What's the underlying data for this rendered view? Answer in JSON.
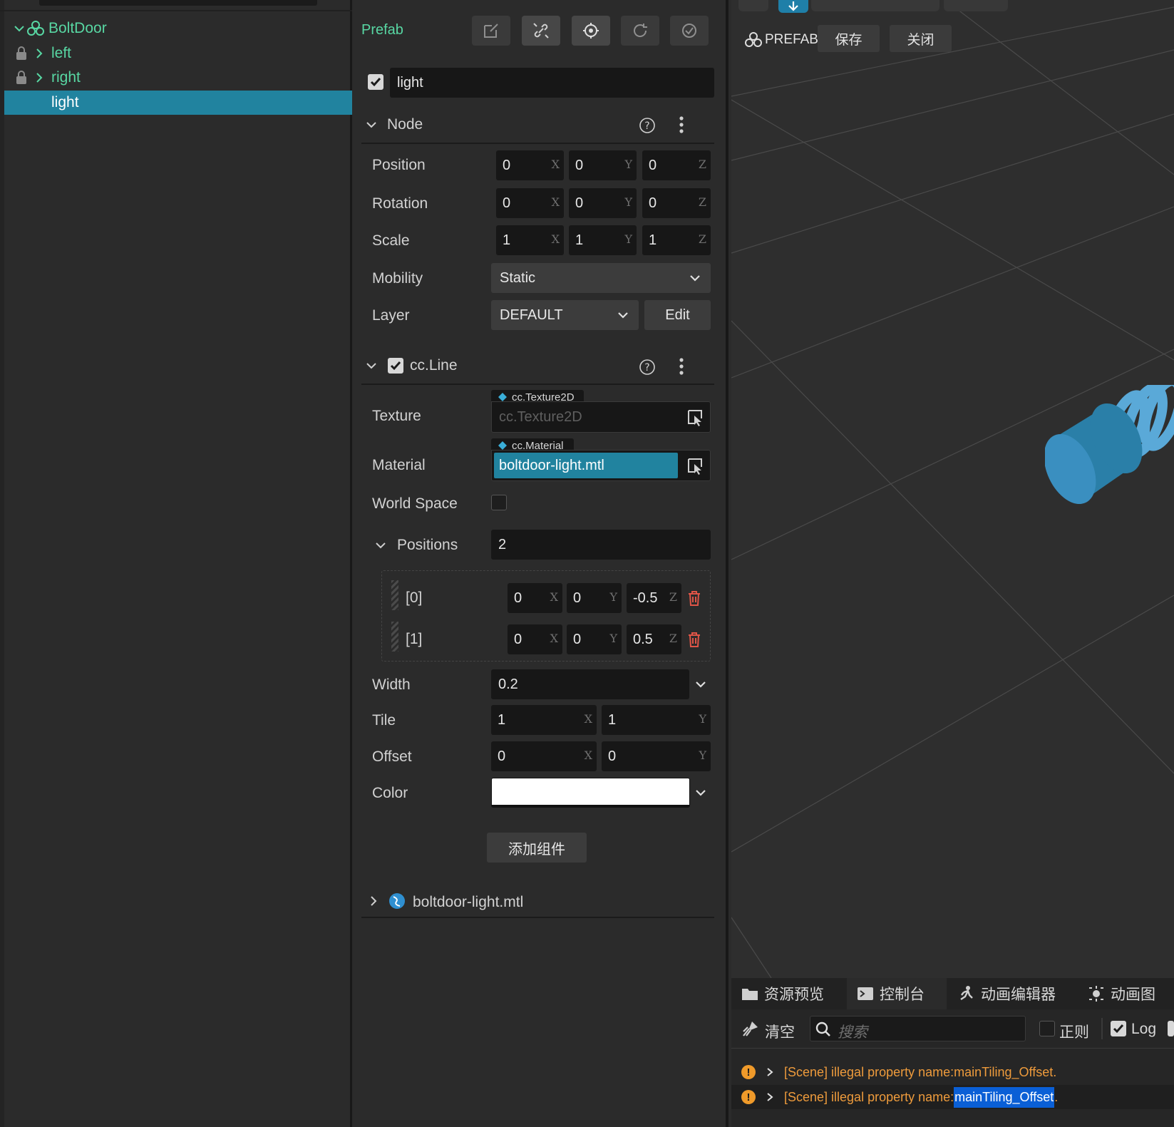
{
  "hierarchy": {
    "items": [
      {
        "label": "BoltDoor"
      },
      {
        "label": "left"
      },
      {
        "label": "right"
      },
      {
        "label": "light"
      }
    ]
  },
  "inspector": {
    "header": "Prefab",
    "node_name": "light",
    "node_section": {
      "title": "Node",
      "position": {
        "label": "Position",
        "x": "0",
        "y": "0",
        "z": "0"
      },
      "rotation": {
        "label": "Rotation",
        "x": "0",
        "y": "0",
        "z": "0"
      },
      "scale": {
        "label": "Scale",
        "x": "1",
        "y": "1",
        "z": "1"
      },
      "mobility": {
        "label": "Mobility",
        "value": "Static"
      },
      "layer": {
        "label": "Layer",
        "value": "DEFAULT",
        "edit": "Edit"
      }
    },
    "line_section": {
      "title": "cc.Line",
      "texture": {
        "label": "Texture",
        "type": "cc.Texture2D",
        "value": "cc.Texture2D"
      },
      "material": {
        "label": "Material",
        "type": "cc.Material",
        "value": "boltdoor-light.mtl"
      },
      "world_space": {
        "label": "World Space"
      },
      "positions": {
        "label": "Positions",
        "count": "2",
        "items": [
          {
            "index": "[0]",
            "x": "0",
            "y": "0",
            "z": "-0.5"
          },
          {
            "index": "[1]",
            "x": "0",
            "y": "0",
            "z": "0.5"
          }
        ]
      },
      "width": {
        "label": "Width",
        "value": "0.2"
      },
      "tile": {
        "label": "Tile",
        "x": "1",
        "y": "1"
      },
      "offset": {
        "label": "Offset",
        "x": "0",
        "y": "0"
      },
      "color": {
        "label": "Color",
        "value": "#ffffff"
      }
    },
    "axis": {
      "x": "X",
      "y": "Y",
      "z": "Z"
    },
    "add_component": "添加组件",
    "material_asset": "boltdoor-light.mtl"
  },
  "scene": {
    "prefab_label": "PREFAB",
    "save": "保存",
    "close": "关闭",
    "accent": "#2a7fa8"
  },
  "console": {
    "tabs": [
      "资源预览",
      "控制台",
      "动画编辑器",
      "动画图"
    ],
    "clear": "清空",
    "search_placeholder": "搜索",
    "regex": "正则",
    "log": "Log",
    "messages": [
      {
        "prefix": "[Scene] illegal property name: ",
        "name": "mainTiling_Offset",
        "suffix": "."
      },
      {
        "prefix": "[Scene] illegal property name: ",
        "name": "mainTiling_Offset",
        "suffix": "."
      }
    ]
  }
}
